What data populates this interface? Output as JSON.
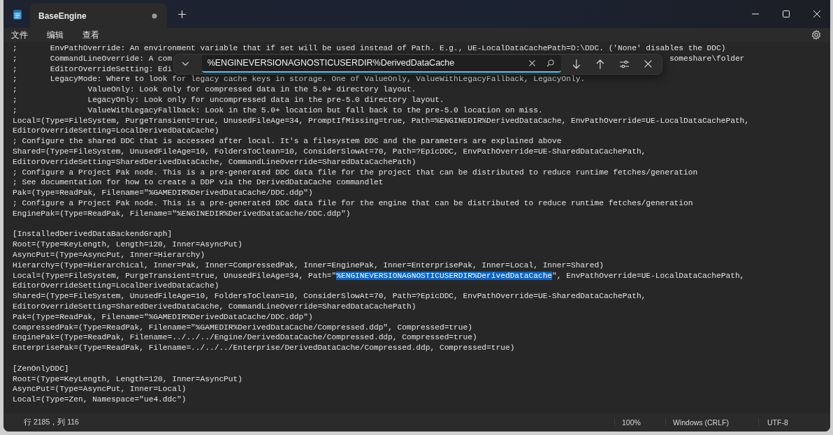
{
  "window": {
    "tab_title": "BaseEngine",
    "tab_unsaved": true
  },
  "menu": [
    "文件",
    "编辑",
    "查看"
  ],
  "find_bar": {
    "value": "%ENGINEVERSIONAGNOSTICUSERDIR%DerivedDataCache"
  },
  "lines": [
    {
      "kind": "text",
      "text": ";       EnvPathOverride: An environment variable that if set will be used instead of Path. E.g., UE-LocalDataCachePath=D:\\DDC. ('None' disables the DDC)"
    },
    {
      "kind": "covered",
      "text": ";       CommandLineOverride: A com",
      "tail": "someshare\\folder"
    },
    {
      "kind": "covered",
      "text": ";       EditorOverrideSetting: Edi"
    },
    {
      "kind": "text",
      "text": ";       LegacyMode: Where to look for legacy cache keys in storage. One of ValueOnly, ValueWithLegacyFallback, LegacyOnly."
    },
    {
      "kind": "text",
      "text": ";               ValueOnly: Look only for compressed data in the 5.0+ directory layout."
    },
    {
      "kind": "text",
      "text": ";               LegacyOnly: Look only for uncompressed data in the pre-5.0 directory layout."
    },
    {
      "kind": "text",
      "text": ";               ValueWithLegacyFallback: Look in the 5.0+ location but fall back to the pre-5.0 location on miss."
    },
    {
      "kind": "text",
      "text": "Local=(Type=FileSystem, PurgeTransient=true, UnusedFileAge=34, PromptIfMissing=true, Path=%ENGINEDIR%DerivedDataCache, EnvPathOverride=UE-LocalDataCachePath,"
    },
    {
      "kind": "text",
      "text": "EditorOverrideSetting=LocalDerivedDataCache)"
    },
    {
      "kind": "text",
      "text": "; Configure the shared DDC that is accessed after local. It's a filesystem DDC and the parameters are explained above"
    },
    {
      "kind": "text",
      "text": "Shared=(Type=FileSystem, UnusedFileAge=10, FoldersToClean=10, ConsiderSlowAt=70, Path=?EpicDDC, EnvPathOverride=UE-SharedDataCachePath,"
    },
    {
      "kind": "text",
      "text": "EditorOverrideSetting=SharedDerivedDataCache, CommandLineOverride=SharedDataCachePath)"
    },
    {
      "kind": "text",
      "text": "; Configure a Project Pak node. This is a pre-generated DDC data file for the project that can be distributed to reduce runtime fetches/generation"
    },
    {
      "kind": "text",
      "text": "; See documentation for how to create a DDP via the DerivedDataCache commandlet"
    },
    {
      "kind": "text",
      "text": "Pak=(Type=ReadPak, Filename=\"%GAMEDIR%DerivedDataCache/DDC.ddp\")"
    },
    {
      "kind": "text",
      "text": "; Configure a Project Pak node. This is a pre-generated DDC data file for the engine that can be distributed to reduce runtime fetches/generation"
    },
    {
      "kind": "text",
      "text": "EnginePak=(Type=ReadPak, Filename=\"%ENGINEDIR%DerivedDataCache/DDC.ddp\")"
    },
    {
      "kind": "blank"
    },
    {
      "kind": "text",
      "text": "[InstalledDerivedDataBackendGraph]"
    },
    {
      "kind": "text",
      "text": "Root=(Type=KeyLength, Length=120, Inner=AsyncPut)"
    },
    {
      "kind": "text",
      "text": "AsyncPut=(Type=AsyncPut, Inner=Hierarchy)"
    },
    {
      "kind": "text",
      "text": "Hierarchy=(Type=Hierarchical, Inner=Pak, Inner=CompressedPak, Inner=EnginePak, Inner=EnterprisePak, Inner=Local, Inner=Shared)"
    },
    {
      "kind": "segments",
      "parts": [
        {
          "text": "Local=(Type=FileSystem, PurgeTransient=true, UnusedFileAge=34, Path=\"",
          "selected": false
        },
        {
          "text": "%ENGINEVERSIONAGNOSTICUSERDIR%DerivedDataCache",
          "selected": true
        },
        {
          "text": "\", EnvPathOverride=UE-LocalDataCachePath,",
          "selected": false
        }
      ]
    },
    {
      "kind": "text",
      "text": "EditorOverrideSetting=LocalDerivedDataCache)"
    },
    {
      "kind": "text",
      "text": "Shared=(Type=FileSystem, UnusedFileAge=10, FoldersToClean=10, ConsiderSlowAt=70, Path=?EpicDDC, EnvPathOverride=UE-SharedDataCachePath,"
    },
    {
      "kind": "text",
      "text": "EditorOverrideSetting=SharedDerivedDataCache, CommandLineOverride=SharedDataCachePath)"
    },
    {
      "kind": "text",
      "text": "Pak=(Type=ReadPak, Filename=\"%GAMEDIR%DerivedDataCache/DDC.ddp\")"
    },
    {
      "kind": "text",
      "text": "CompressedPak=(Type=ReadPak, Filename=\"%GAMEDIR%DerivedDataCache/Compressed.ddp\", Compressed=true)"
    },
    {
      "kind": "text",
      "text": "EnginePak=(Type=ReadPak, Filename=../../../Engine/DerivedDataCache/Compressed.ddp, Compressed=true)"
    },
    {
      "kind": "text",
      "text": "EnterprisePak=(Type=ReadPak, Filename=../../../Enterprise/DerivedDataCache/Compressed.ddp, Compressed=true)"
    },
    {
      "kind": "blank"
    },
    {
      "kind": "text",
      "text": "[ZenOnlyDDC]"
    },
    {
      "kind": "text",
      "text": "Root=(Type=KeyLength, Length=120, Inner=AsyncPut)"
    },
    {
      "kind": "text",
      "text": "AsyncPut=(Type=AsyncPut, Inner=Local)"
    },
    {
      "kind": "text",
      "text": "Local=(Type=Zen, Namespace=\"ue4.ddc\")"
    }
  ],
  "status_bar": {
    "position": "行 2185，列 116",
    "zoom": "100%",
    "line_ending": "Windows (CRLF)",
    "encoding": "UTF-8"
  }
}
